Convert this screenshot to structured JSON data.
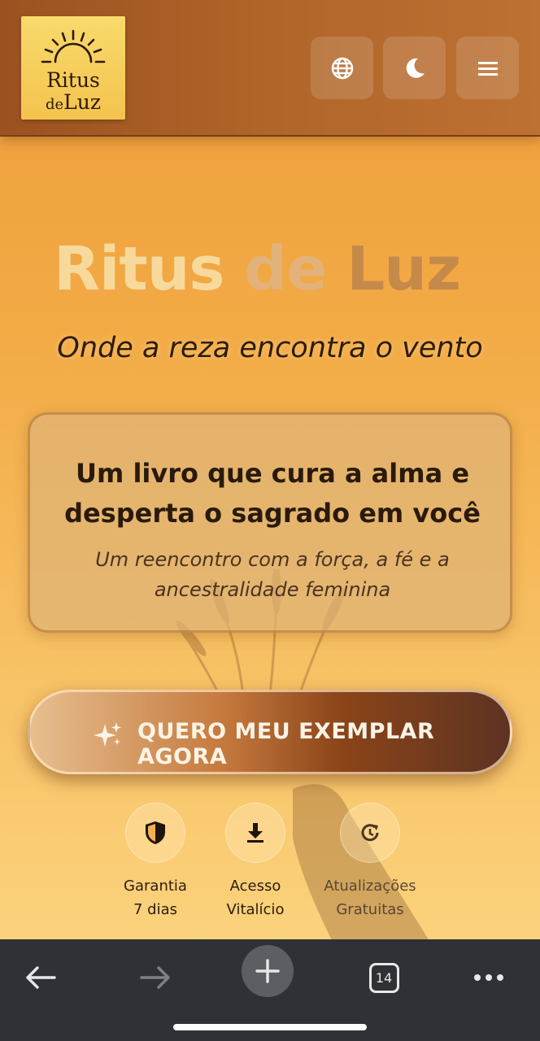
{
  "header": {
    "logo": {
      "line1": "Ritus",
      "line2_small": "de",
      "line2_big": "Luz"
    },
    "buttons": [
      {
        "icon": "globe-icon"
      },
      {
        "icon": "moon-icon"
      },
      {
        "icon": "menu-icon"
      }
    ]
  },
  "hero": {
    "title_word1": "Ritus",
    "title_word2": "de",
    "title_word3": "Luz",
    "tagline": "Onde a reza encontra o vento"
  },
  "card": {
    "title_line1": "Um livro que cura a alma e",
    "title_line2": "desperta o sagrado em você",
    "subtitle_line1": "Um reencontro com a força, a fé e a",
    "subtitle_line2": "ancestralidade feminina"
  },
  "cta": {
    "icon": "sparkles-icon",
    "label": "QUERO MEU EXEMPLAR AGORA"
  },
  "features": [
    {
      "icon": "shield-icon",
      "line1": "Garantia",
      "line2": "7 dias"
    },
    {
      "icon": "download-icon",
      "line1": "Acesso",
      "line2": "Vitalício"
    },
    {
      "icon": "refresh-clock-icon",
      "line1": "Atualizações",
      "line2": "Gratuitas"
    }
  ],
  "browser_bar": {
    "tab_count": "14",
    "buttons": [
      "back-icon",
      "forward-icon",
      "new-tab-icon",
      "tabs-icon",
      "more-icon"
    ]
  },
  "colors": {
    "header_brown": "#b0652a",
    "page_orange": "#f2aa45",
    "logo_gold": "#f4c34e",
    "cta_dark": "#8a4418",
    "toolbar": "#2e3236"
  }
}
